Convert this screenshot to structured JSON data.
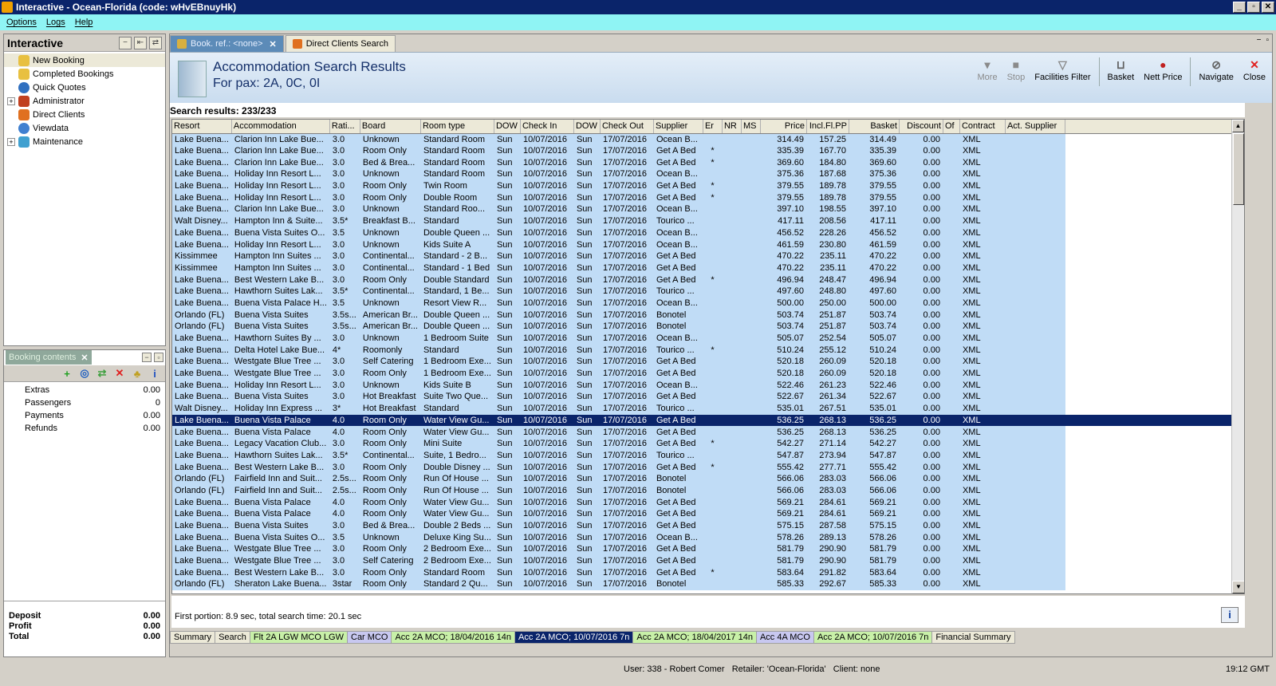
{
  "window": {
    "title": "Interactive - Ocean-Florida (code: wHvEBnuyHk)",
    "btn_min": "_",
    "btn_max": "▫",
    "btn_close": "✕"
  },
  "menu": [
    "Options",
    "Logs",
    "Help"
  ],
  "nav": {
    "title": "Interactive",
    "items": [
      "New Booking",
      "Completed Bookings",
      "Quick Quotes",
      "Administrator",
      "Direct Clients",
      "Viewdata",
      "Maintenance"
    ]
  },
  "booking": {
    "tab": "Booking contents",
    "rows": [
      {
        "label": "Extras",
        "value": "0.00"
      },
      {
        "label": "Passengers",
        "value": "0"
      },
      {
        "label": "Payments",
        "value": "0.00"
      },
      {
        "label": "Refunds",
        "value": "0.00"
      }
    ],
    "totals": [
      {
        "label": "Deposit",
        "value": "0.00"
      },
      {
        "label": "Profit",
        "value": "0.00"
      },
      {
        "label": "Total",
        "value": "0.00"
      }
    ]
  },
  "tabs": {
    "active": "Book. ref.: <none>",
    "other": "Direct Clients Search"
  },
  "header": {
    "title": "Accommodation Search Results",
    "subtitle": "For pax: 2A, 0C, 0I"
  },
  "toolbar": {
    "more": "More",
    "stop": "Stop",
    "facilities": "Facilities Filter",
    "basket": "Basket",
    "nett": "Nett Price",
    "navigate": "Navigate",
    "close": "Close"
  },
  "results_label": "Search results: 233/233",
  "columns": [
    "Resort",
    "Accommodation",
    "Rati...",
    "Board",
    "Room type",
    "DOW",
    "Check In",
    "DOW",
    "Check Out",
    "Supplier",
    "Er",
    "NR",
    "MS",
    "Price",
    "Incl.Fl.PP",
    "Basket",
    "Discount",
    "Of",
    "Contract",
    "Act. Supplier"
  ],
  "rows": [
    [
      "Lake Buena...",
      "Clarion Inn Lake Bue...",
      "3.0",
      "Unknown",
      "Standard Room",
      "Sun",
      "10/07/2016",
      "Sun",
      "17/07/2016",
      "Ocean B...",
      "",
      "",
      "",
      "314.49",
      "157.25",
      "314.49",
      "0.00",
      "",
      "XML",
      ""
    ],
    [
      "Lake Buena...",
      "Clarion Inn Lake Bue...",
      "3.0",
      "Room Only",
      "Standard Room",
      "Sun",
      "10/07/2016",
      "Sun",
      "17/07/2016",
      "Get A Bed",
      "*",
      "",
      "",
      "335.39",
      "167.70",
      "335.39",
      "0.00",
      "",
      "XML",
      ""
    ],
    [
      "Lake Buena...",
      "Clarion Inn Lake Bue...",
      "3.0",
      "Bed & Brea...",
      "Standard Room",
      "Sun",
      "10/07/2016",
      "Sun",
      "17/07/2016",
      "Get A Bed",
      "*",
      "",
      "",
      "369.60",
      "184.80",
      "369.60",
      "0.00",
      "",
      "XML",
      ""
    ],
    [
      "Lake Buena...",
      "Holiday Inn Resort L...",
      "3.0",
      "Unknown",
      "Standard Room",
      "Sun",
      "10/07/2016",
      "Sun",
      "17/07/2016",
      "Ocean B...",
      "",
      "",
      "",
      "375.36",
      "187.68",
      "375.36",
      "0.00",
      "",
      "XML",
      ""
    ],
    [
      "Lake Buena...",
      "Holiday Inn Resort L...",
      "3.0",
      "Room Only",
      "Twin Room",
      "Sun",
      "10/07/2016",
      "Sun",
      "17/07/2016",
      "Get A Bed",
      "*",
      "",
      "",
      "379.55",
      "189.78",
      "379.55",
      "0.00",
      "",
      "XML",
      ""
    ],
    [
      "Lake Buena...",
      "Holiday Inn Resort L...",
      "3.0",
      "Room Only",
      "Double Room",
      "Sun",
      "10/07/2016",
      "Sun",
      "17/07/2016",
      "Get A Bed",
      "*",
      "",
      "",
      "379.55",
      "189.78",
      "379.55",
      "0.00",
      "",
      "XML",
      ""
    ],
    [
      "Lake Buena...",
      "Clarion Inn Lake Bue...",
      "3.0",
      "Unknown",
      "Standard Roo...",
      "Sun",
      "10/07/2016",
      "Sun",
      "17/07/2016",
      "Ocean B...",
      "",
      "",
      "",
      "397.10",
      "198.55",
      "397.10",
      "0.00",
      "",
      "XML",
      ""
    ],
    [
      "Walt Disney...",
      "Hampton Inn & Suite...",
      "3.5*",
      "Breakfast B...",
      "Standard",
      "Sun",
      "10/07/2016",
      "Sun",
      "17/07/2016",
      "Tourico ...",
      "",
      "",
      "",
      "417.11",
      "208.56",
      "417.11",
      "0.00",
      "",
      "XML",
      ""
    ],
    [
      "Lake Buena...",
      "Buena Vista Suites O...",
      "3.5",
      "Unknown",
      "Double Queen ...",
      "Sun",
      "10/07/2016",
      "Sun",
      "17/07/2016",
      "Ocean B...",
      "",
      "",
      "",
      "456.52",
      "228.26",
      "456.52",
      "0.00",
      "",
      "XML",
      ""
    ],
    [
      "Lake Buena...",
      "Holiday Inn Resort L...",
      "3.0",
      "Unknown",
      "Kids Suite A",
      "Sun",
      "10/07/2016",
      "Sun",
      "17/07/2016",
      "Ocean B...",
      "",
      "",
      "",
      "461.59",
      "230.80",
      "461.59",
      "0.00",
      "",
      "XML",
      ""
    ],
    [
      "Kissimmee",
      "Hampton Inn Suites ...",
      "3.0",
      "Continental...",
      "Standard - 2 B...",
      "Sun",
      "10/07/2016",
      "Sun",
      "17/07/2016",
      "Get A Bed",
      "",
      "",
      "",
      "470.22",
      "235.11",
      "470.22",
      "0.00",
      "",
      "XML",
      ""
    ],
    [
      "Kissimmee",
      "Hampton Inn Suites ...",
      "3.0",
      "Continental...",
      "Standard - 1 Bed",
      "Sun",
      "10/07/2016",
      "Sun",
      "17/07/2016",
      "Get A Bed",
      "",
      "",
      "",
      "470.22",
      "235.11",
      "470.22",
      "0.00",
      "",
      "XML",
      ""
    ],
    [
      "Lake Buena...",
      "Best Western Lake B...",
      "3.0",
      "Room Only",
      "Double Standard",
      "Sun",
      "10/07/2016",
      "Sun",
      "17/07/2016",
      "Get A Bed",
      "*",
      "",
      "",
      "496.94",
      "248.47",
      "496.94",
      "0.00",
      "",
      "XML",
      ""
    ],
    [
      "Lake Buena...",
      "Hawthorn Suites Lak...",
      "3.5*",
      "Continental...",
      "Standard, 1 Be...",
      "Sun",
      "10/07/2016",
      "Sun",
      "17/07/2016",
      "Tourico ...",
      "",
      "",
      "",
      "497.60",
      "248.80",
      "497.60",
      "0.00",
      "",
      "XML",
      ""
    ],
    [
      "Lake Buena...",
      "Buena Vista Palace H...",
      "3.5",
      "Unknown",
      "Resort View R...",
      "Sun",
      "10/07/2016",
      "Sun",
      "17/07/2016",
      "Ocean B...",
      "",
      "",
      "",
      "500.00",
      "250.00",
      "500.00",
      "0.00",
      "",
      "XML",
      ""
    ],
    [
      "Orlando (FL)",
      "Buena Vista Suites",
      "3.5s...",
      "American Br...",
      "Double Queen ...",
      "Sun",
      "10/07/2016",
      "Sun",
      "17/07/2016",
      "Bonotel",
      "",
      "",
      "",
      "503.74",
      "251.87",
      "503.74",
      "0.00",
      "",
      "XML",
      ""
    ],
    [
      "Orlando (FL)",
      "Buena Vista Suites",
      "3.5s...",
      "American Br...",
      "Double Queen ...",
      "Sun",
      "10/07/2016",
      "Sun",
      "17/07/2016",
      "Bonotel",
      "",
      "",
      "",
      "503.74",
      "251.87",
      "503.74",
      "0.00",
      "",
      "XML",
      ""
    ],
    [
      "Lake Buena...",
      "Hawthorn Suites By ...",
      "3.0",
      "Unknown",
      "1 Bedroom Suite",
      "Sun",
      "10/07/2016",
      "Sun",
      "17/07/2016",
      "Ocean B...",
      "",
      "",
      "",
      "505.07",
      "252.54",
      "505.07",
      "0.00",
      "",
      "XML",
      ""
    ],
    [
      "Lake Buena...",
      "Delta Hotel Lake Bue...",
      "4*",
      "Roomonly",
      "Standard",
      "Sun",
      "10/07/2016",
      "Sun",
      "17/07/2016",
      "Tourico ...",
      "*",
      "",
      "",
      "510.24",
      "255.12",
      "510.24",
      "0.00",
      "",
      "XML",
      ""
    ],
    [
      "Lake Buena...",
      "Westgate Blue Tree ...",
      "3.0",
      "Self Catering",
      "1 Bedroom Exe...",
      "Sun",
      "10/07/2016",
      "Sun",
      "17/07/2016",
      "Get A Bed",
      "",
      "",
      "",
      "520.18",
      "260.09",
      "520.18",
      "0.00",
      "",
      "XML",
      ""
    ],
    [
      "Lake Buena...",
      "Westgate Blue Tree ...",
      "3.0",
      "Room Only",
      "1 Bedroom Exe...",
      "Sun",
      "10/07/2016",
      "Sun",
      "17/07/2016",
      "Get A Bed",
      "",
      "",
      "",
      "520.18",
      "260.09",
      "520.18",
      "0.00",
      "",
      "XML",
      ""
    ],
    [
      "Lake Buena...",
      "Holiday Inn Resort L...",
      "3.0",
      "Unknown",
      "Kids Suite B",
      "Sun",
      "10/07/2016",
      "Sun",
      "17/07/2016",
      "Ocean B...",
      "",
      "",
      "",
      "522.46",
      "261.23",
      "522.46",
      "0.00",
      "",
      "XML",
      ""
    ],
    [
      "Lake Buena...",
      "Buena Vista Suites",
      "3.0",
      "Hot Breakfast",
      "Suite Two Que...",
      "Sun",
      "10/07/2016",
      "Sun",
      "17/07/2016",
      "Get A Bed",
      "",
      "",
      "",
      "522.67",
      "261.34",
      "522.67",
      "0.00",
      "",
      "XML",
      ""
    ],
    [
      "Walt Disney...",
      "Holiday Inn Express ...",
      "3*",
      "Hot Breakfast",
      "Standard",
      "Sun",
      "10/07/2016",
      "Sun",
      "17/07/2016",
      "Tourico ...",
      "",
      "",
      "",
      "535.01",
      "267.51",
      "535.01",
      "0.00",
      "",
      "XML",
      ""
    ],
    [
      "Lake Buena...",
      "Buena Vista Palace",
      "4.0",
      "Room Only",
      "Water View Gu...",
      "Sun",
      "10/07/2016",
      "Sun",
      "17/07/2016",
      "Get A Bed",
      "",
      "",
      "",
      "536.25",
      "268.13",
      "536.25",
      "0.00",
      "",
      "XML",
      ""
    ],
    [
      "Lake Buena...",
      "Buena Vista Palace",
      "4.0",
      "Room Only",
      "Water View Gu...",
      "Sun",
      "10/07/2016",
      "Sun",
      "17/07/2016",
      "Get A Bed",
      "",
      "",
      "",
      "536.25",
      "268.13",
      "536.25",
      "0.00",
      "",
      "XML",
      ""
    ],
    [
      "Lake Buena...",
      "Legacy Vacation Club...",
      "3.0",
      "Room Only",
      "Mini Suite",
      "Sun",
      "10/07/2016",
      "Sun",
      "17/07/2016",
      "Get A Bed",
      "*",
      "",
      "",
      "542.27",
      "271.14",
      "542.27",
      "0.00",
      "",
      "XML",
      ""
    ],
    [
      "Lake Buena...",
      "Hawthorn Suites Lak...",
      "3.5*",
      "Continental...",
      "Suite, 1 Bedro...",
      "Sun",
      "10/07/2016",
      "Sun",
      "17/07/2016",
      "Tourico ...",
      "",
      "",
      "",
      "547.87",
      "273.94",
      "547.87",
      "0.00",
      "",
      "XML",
      ""
    ],
    [
      "Lake Buena...",
      "Best Western Lake B...",
      "3.0",
      "Room Only",
      "Double Disney ...",
      "Sun",
      "10/07/2016",
      "Sun",
      "17/07/2016",
      "Get A Bed",
      "*",
      "",
      "",
      "555.42",
      "277.71",
      "555.42",
      "0.00",
      "",
      "XML",
      ""
    ],
    [
      "Orlando (FL)",
      "Fairfield Inn and Suit...",
      "2.5s...",
      "Room Only",
      "Run Of House ...",
      "Sun",
      "10/07/2016",
      "Sun",
      "17/07/2016",
      "Bonotel",
      "",
      "",
      "",
      "566.06",
      "283.03",
      "566.06",
      "0.00",
      "",
      "XML",
      ""
    ],
    [
      "Orlando (FL)",
      "Fairfield Inn and Suit...",
      "2.5s...",
      "Room Only",
      "Run Of House ...",
      "Sun",
      "10/07/2016",
      "Sun",
      "17/07/2016",
      "Bonotel",
      "",
      "",
      "",
      "566.06",
      "283.03",
      "566.06",
      "0.00",
      "",
      "XML",
      ""
    ],
    [
      "Lake Buena...",
      "Buena Vista Palace",
      "4.0",
      "Room Only",
      "Water View Gu...",
      "Sun",
      "10/07/2016",
      "Sun",
      "17/07/2016",
      "Get A Bed",
      "",
      "",
      "",
      "569.21",
      "284.61",
      "569.21",
      "0.00",
      "",
      "XML",
      ""
    ],
    [
      "Lake Buena...",
      "Buena Vista Palace",
      "4.0",
      "Room Only",
      "Water View Gu...",
      "Sun",
      "10/07/2016",
      "Sun",
      "17/07/2016",
      "Get A Bed",
      "",
      "",
      "",
      "569.21",
      "284.61",
      "569.21",
      "0.00",
      "",
      "XML",
      ""
    ],
    [
      "Lake Buena...",
      "Buena Vista Suites",
      "3.0",
      "Bed & Brea...",
      "Double 2 Beds ...",
      "Sun",
      "10/07/2016",
      "Sun",
      "17/07/2016",
      "Get A Bed",
      "",
      "",
      "",
      "575.15",
      "287.58",
      "575.15",
      "0.00",
      "",
      "XML",
      ""
    ],
    [
      "Lake Buena...",
      "Buena Vista Suites O...",
      "3.5",
      "Unknown",
      "Deluxe King Su...",
      "Sun",
      "10/07/2016",
      "Sun",
      "17/07/2016",
      "Ocean B...",
      "",
      "",
      "",
      "578.26",
      "289.13",
      "578.26",
      "0.00",
      "",
      "XML",
      ""
    ],
    [
      "Lake Buena...",
      "Westgate Blue Tree ...",
      "3.0",
      "Room Only",
      "2 Bedroom Exe...",
      "Sun",
      "10/07/2016",
      "Sun",
      "17/07/2016",
      "Get A Bed",
      "",
      "",
      "",
      "581.79",
      "290.90",
      "581.79",
      "0.00",
      "",
      "XML",
      ""
    ],
    [
      "Lake Buena...",
      "Westgate Blue Tree ...",
      "3.0",
      "Self Catering",
      "2 Bedroom Exe...",
      "Sun",
      "10/07/2016",
      "Sun",
      "17/07/2016",
      "Get A Bed",
      "",
      "",
      "",
      "581.79",
      "290.90",
      "581.79",
      "0.00",
      "",
      "XML",
      ""
    ],
    [
      "Lake Buena...",
      "Best Western Lake B...",
      "3.0",
      "Room Only",
      "Standard Room",
      "Sun",
      "10/07/2016",
      "Sun",
      "17/07/2016",
      "Get A Bed",
      "*",
      "",
      "",
      "583.64",
      "291.82",
      "583.64",
      "0.00",
      "",
      "XML",
      ""
    ],
    [
      "Orlando (FL)",
      "Sheraton Lake Buena...",
      "3star",
      "Room Only",
      "Standard 2 Qu...",
      "Sun",
      "10/07/2016",
      "Sun",
      "17/07/2016",
      "Bonotel",
      "",
      "",
      "",
      "585.33",
      "292.67",
      "585.33",
      "0.00",
      "",
      "XML",
      ""
    ]
  ],
  "selected_row": 24,
  "timing": "First portion: 8.9 sec, total search time: 20.1 sec",
  "subtabs": [
    {
      "label": "Summary",
      "color": "#ece9d8",
      "fg": "#000000"
    },
    {
      "label": "Search",
      "color": "#ece9d8",
      "fg": "#000000"
    },
    {
      "label": "Flt 2A LGW MCO LGW",
      "color": "#c8f0a8",
      "fg": "#000000"
    },
    {
      "label": "Car MCO",
      "color": "#c8c8f0",
      "fg": "#000000"
    },
    {
      "label": "Acc 2A MCO; 18/04/2016 14n",
      "color": "#c8f0a8",
      "fg": "#000000"
    },
    {
      "label": "Acc 2A MCO; 10/07/2016 7n",
      "color": "#0a246a",
      "fg": "#ffffff"
    },
    {
      "label": "Acc 2A MCO; 18/04/2017 14n",
      "color": "#c8f0a8",
      "fg": "#000000"
    },
    {
      "label": "Acc 4A MCO",
      "color": "#c8c8f0",
      "fg": "#000000"
    },
    {
      "label": "Acc 2A MCO; 10/07/2016 7n",
      "color": "#c8f0a8",
      "fg": "#000000"
    },
    {
      "label": "Financial Summary",
      "color": "#ece9d8",
      "fg": "#000000"
    }
  ],
  "status": {
    "text": "User: 338 - Robert Comer   Retailer: 'Ocean-Florida'   Client: none",
    "clock": "19:12 GMT"
  },
  "colors": {
    "selection": "#0a246a",
    "row_fill": "#c0dcf6",
    "menubar": "#8ff4f4"
  }
}
